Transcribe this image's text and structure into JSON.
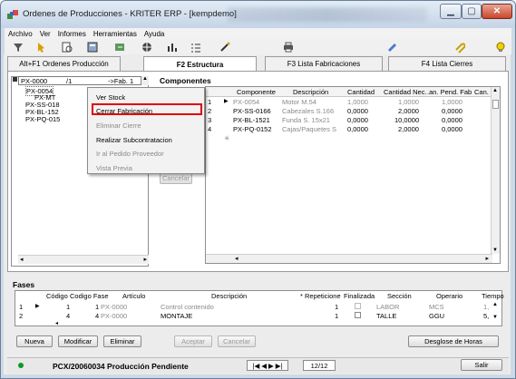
{
  "window": {
    "title": "Ordenes de Producciones - KRITER ERP - [kempdemo]"
  },
  "menu": [
    "Archivo",
    "Ver",
    "Informes",
    "Herramientas",
    "Ayuda"
  ],
  "tabs": [
    {
      "label": "Alt+F1 Ordenes Producción",
      "active": false
    },
    {
      "label": "F2 Estructura",
      "active": true
    },
    {
      "label": "F3 Lista Fabricaciones",
      "active": false
    },
    {
      "label": "F4 Lista Cierres",
      "active": false
    }
  ],
  "tree": {
    "combo_left": "PX-0000",
    "combo_mid": "/1",
    "combo_right": "->Fab. 1",
    "nodes": [
      "PX-0054",
      "PX-MT",
      "PX-SS-018",
      "PX-BL-152",
      "PX-PQ-015"
    ]
  },
  "components": {
    "title": "Componentes",
    "columns": [
      "Componente",
      "Descripción",
      "Cantidad",
      "Cantidad Nec.",
      ".an. Pend. Fab",
      "Can. I"
    ],
    "rows": [
      {
        "idx": "1",
        "code": "PX-0054",
        "desc": "Motor M.54",
        "qty": "1,0000",
        "need": "1,0000",
        "pend": "1,0000"
      },
      {
        "idx": "2",
        "code": "PX-SS-0166",
        "desc": "Cabezales S.166",
        "qty": "0,0000",
        "need": "2,0000",
        "pend": "0,0000"
      },
      {
        "idx": "3",
        "code": "PX-BL-1521",
        "desc": "Funda S. 15x21",
        "qty": "0,0000",
        "need": "10,0000",
        "pend": "0,0000"
      },
      {
        "idx": "4",
        "code": "PX-PQ-0152",
        "desc": "Cajas/Paquetes S",
        "qty": "0,0000",
        "need": "2,0000",
        "pend": "0,0000"
      }
    ],
    "cancel_label": "Cancelar"
  },
  "context_menu": {
    "items": [
      {
        "label": "Ver Stock",
        "disabled": false
      },
      {
        "label": "Cerrar Fabricación",
        "disabled": false
      },
      {
        "label": "Eliminar Cierre",
        "disabled": true
      },
      {
        "label": "Realizar Subcontratacion",
        "disabled": false
      },
      {
        "label": "Ir al Pedido Proveedor",
        "disabled": true
      },
      {
        "label": "Vista Previa",
        "disabled": true
      }
    ]
  },
  "fases": {
    "title": "Fases",
    "columns": [
      "Código",
      "Codigo Fase",
      "Artículo",
      "Descripción",
      "* Repeticione",
      "Finalizada",
      "Sección",
      "Operario",
      "Tiempo"
    ],
    "rows": [
      {
        "row": "1",
        "code": "1",
        "phase": "1",
        "article": "PX-0000",
        "desc": "Control contenido",
        "rep": "1",
        "section": "LABOR",
        "operator": "MCS",
        "time": "1,"
      },
      {
        "row": "2",
        "code": "4",
        "phase": "4",
        "article": "PX-0000",
        "desc": "MONTAJE",
        "rep": "1",
        "section": "TALLE",
        "operator": "GGU",
        "time": "5,"
      }
    ]
  },
  "buttons": {
    "nueva": "Nueva",
    "modificar": "Modificar",
    "eliminar": "Eliminar",
    "aceptar": "Aceptar",
    "cancelar": "Cancelar",
    "desglose": "Desglose de Horas",
    "salir": "Salir"
  },
  "status": {
    "text": "PCX/20060034 Producción Pendiente",
    "page": "12/12"
  }
}
